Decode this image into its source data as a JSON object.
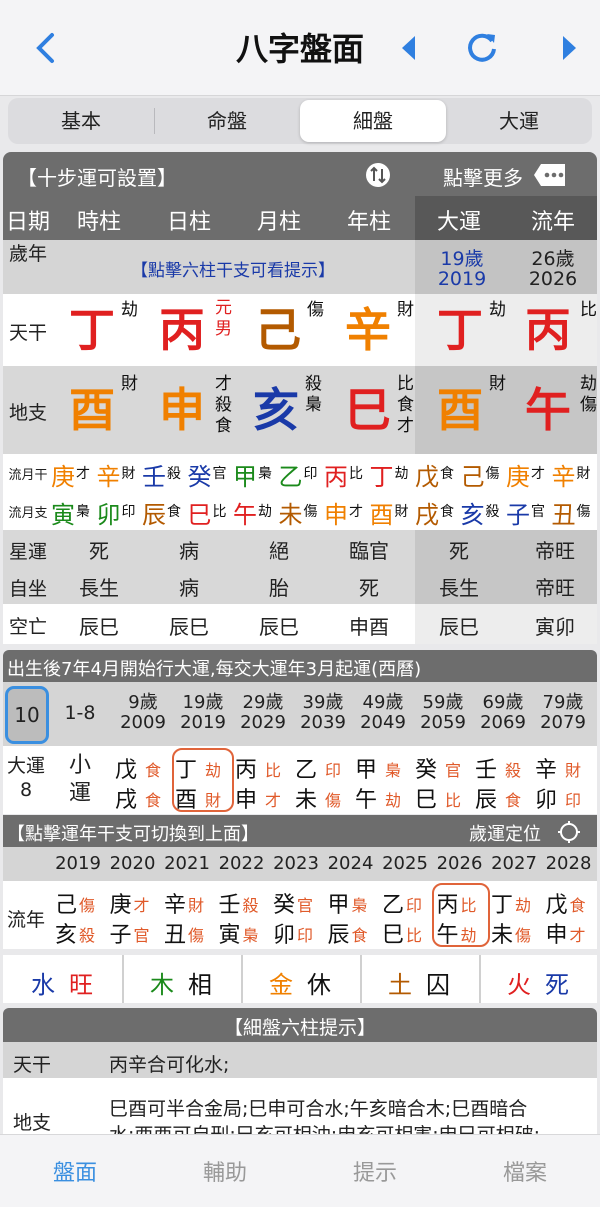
{
  "nav": {
    "title": "八字盤面"
  },
  "tabs": [
    "基本",
    "命盤",
    "細盤",
    "大運"
  ],
  "panel1": {
    "title": "【十步運可設置】",
    "more": "點擊更多"
  },
  "cols": {
    "headers": [
      "日期",
      "時柱",
      "日柱",
      "月柱",
      "年柱",
      "大運",
      "流年"
    ]
  },
  "age_row": {
    "label": "歲年",
    "hint": "【點擊六柱干支可看提示】",
    "dy_age": "19歲",
    "dy_year": "2019",
    "ln_age": "26歲",
    "ln_year": "2026"
  },
  "tg": {
    "label": "天干",
    "stems": [
      {
        "ch": "丁",
        "god": "劫"
      },
      {
        "ch": "丙",
        "god": "元\n男"
      },
      {
        "ch": "己",
        "god": "傷"
      },
      {
        "ch": "辛",
        "god": "財"
      },
      {
        "ch": "丁",
        "god": "劫"
      },
      {
        "ch": "丙",
        "god": "比"
      }
    ]
  },
  "dz": {
    "label": "地支",
    "branches": [
      {
        "ch": "酉",
        "god": "財"
      },
      {
        "ch": "申",
        "god": "才\n殺\n食"
      },
      {
        "ch": "亥",
        "god": "殺\n梟"
      },
      {
        "ch": "巳",
        "god": "比\n食\n才"
      },
      {
        "ch": "酉",
        "god": "財"
      },
      {
        "ch": "午",
        "god": "劫\n傷"
      }
    ]
  },
  "lyg": {
    "label": "流月干",
    "items": [
      [
        "庚",
        "才"
      ],
      [
        "辛",
        "財"
      ],
      [
        "壬",
        "殺"
      ],
      [
        "癸",
        "官"
      ],
      [
        "甲",
        "梟"
      ],
      [
        "乙",
        "印"
      ],
      [
        "丙",
        "比"
      ],
      [
        "丁",
        "劫"
      ],
      [
        "戊",
        "食"
      ],
      [
        "己",
        "傷"
      ],
      [
        "庚",
        "才"
      ],
      [
        "辛",
        "財"
      ]
    ]
  },
  "lyz": {
    "label": "流月支",
    "items": [
      [
        "寅",
        "梟"
      ],
      [
        "卯",
        "印"
      ],
      [
        "辰",
        "食"
      ],
      [
        "巳",
        "比"
      ],
      [
        "午",
        "劫"
      ],
      [
        "未",
        "傷"
      ],
      [
        "申",
        "才"
      ],
      [
        "酉",
        "財"
      ],
      [
        "戌",
        "食"
      ],
      [
        "亥",
        "殺"
      ],
      [
        "子",
        "官"
      ],
      [
        "丑",
        "傷"
      ]
    ]
  },
  "xingyun": {
    "label": "星運",
    "vals": [
      "死",
      "病",
      "絕",
      "臨官",
      "死",
      "帝旺"
    ]
  },
  "zizuo": {
    "label": "自坐",
    "vals": [
      "長生",
      "病",
      "胎",
      "死",
      "長生",
      "帝旺"
    ]
  },
  "kongwang": {
    "label": "空亡",
    "vals": [
      "辰巳",
      "辰巳",
      "辰巳",
      "申酉",
      "辰巳",
      "寅卯"
    ]
  },
  "dayun": {
    "start": "出生後7年4月開始行大運,每交大運年3月起運(西曆)",
    "sel": "10",
    "range": "1-8",
    "ages": [
      "9歲",
      "19歲",
      "29歲",
      "39歲",
      "49歲",
      "59歲",
      "69歲",
      "79歲"
    ],
    "years": [
      "2009",
      "2019",
      "2029",
      "2039",
      "2049",
      "2059",
      "2069",
      "2079"
    ],
    "label1": "大運",
    "label2": "8",
    "first": [
      "小",
      "運"
    ],
    "pillars": [
      [
        "戊",
        "食",
        "戌",
        "食"
      ],
      [
        "丁",
        "劫",
        "酉",
        "財"
      ],
      [
        "丙",
        "比",
        "申",
        "才"
      ],
      [
        "乙",
        "印",
        "未",
        "傷"
      ],
      [
        "甲",
        "梟",
        "午",
        "劫"
      ],
      [
        "癸",
        "官",
        "巳",
        "比"
      ],
      [
        "壬",
        "殺",
        "辰",
        "食"
      ],
      [
        "辛",
        "財",
        "卯",
        "印"
      ]
    ]
  },
  "liunian": {
    "hint": "【點擊運年干支可切換到上面】",
    "locate": "歲運定位",
    "label": "流年",
    "years": [
      "2019",
      "2020",
      "2021",
      "2022",
      "2023",
      "2024",
      "2025",
      "2026",
      "2027",
      "2028"
    ],
    "pillars": [
      [
        "己",
        "傷",
        "亥",
        "殺"
      ],
      [
        "庚",
        "才",
        "子",
        "官"
      ],
      [
        "辛",
        "財",
        "丑",
        "傷"
      ],
      [
        "壬",
        "殺",
        "寅",
        "梟"
      ],
      [
        "癸",
        "官",
        "卯",
        "印"
      ],
      [
        "甲",
        "梟",
        "辰",
        "食"
      ],
      [
        "乙",
        "印",
        "巳",
        "比"
      ],
      [
        "丙",
        "比",
        "午",
        "劫"
      ],
      [
        "丁",
        "劫",
        "未",
        "傷"
      ],
      [
        "戊",
        "食",
        "申",
        "才"
      ]
    ]
  },
  "wx": [
    [
      "水",
      "旺"
    ],
    [
      "木",
      "相"
    ],
    [
      "金",
      "休"
    ],
    [
      "土",
      "囚"
    ],
    [
      "火",
      "死"
    ]
  ],
  "tips": {
    "title": "【細盤六柱提示】",
    "tg_label": "天干",
    "tg_text": "丙辛合可化水;",
    "dz_label": "地支",
    "dz_text1": "巳酉可半合金局;巳申可合水;午亥暗合木;巳酉暗合",
    "dz_text2": "水;酉酉可自刑;巳亥可相沖;申亥可相害;申巳可相破;"
  },
  "bottom": [
    "盤面",
    "輔助",
    "提示",
    "檔案"
  ]
}
